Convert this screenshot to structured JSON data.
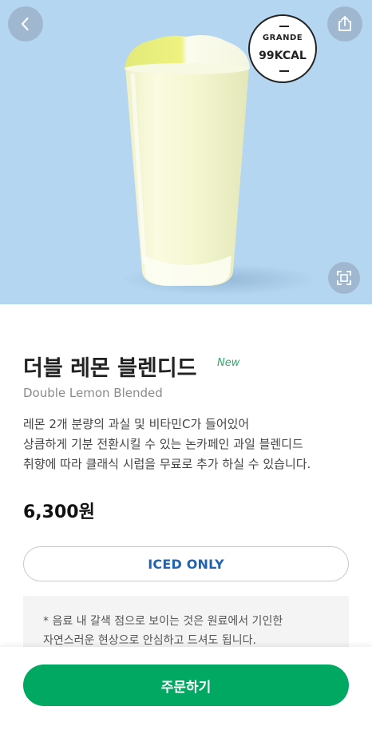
{
  "product": {
    "kcal_size": "GRANDE",
    "kcal_value": "99KCAL",
    "name_ko": "더블 레몬 블렌디드",
    "new_tag": "New",
    "name_en": "Double Lemon Blended",
    "description": [
      "레몬 2개 분량의 과실 및 비타민C가 들어있어",
      "상큼하게 기분 전환시킬 수 있는 논카페인 과일 블렌디드",
      "취향에 따라 클래식 시럽을 무료로 추가 하실 수 있습니다."
    ],
    "price": "6,300원",
    "temperature_option": "ICED ONLY"
  },
  "notice": {
    "lines": [
      "* 음료 내 갈색 점으로 보이는 것은 원료에서 기인한",
      "자연스러운 현상으로 안심하고 드셔도 됩니다."
    ]
  },
  "actions": {
    "order_label": "주문하기"
  },
  "icons": {
    "back": "chevron-left-icon",
    "share": "share-icon",
    "zoom": "expand-icon"
  },
  "colors": {
    "hero_background": "#b5d6f0",
    "accent_green": "#00a862",
    "new_tag_green": "#2eac69",
    "iced_blue": "#1e64b4"
  }
}
